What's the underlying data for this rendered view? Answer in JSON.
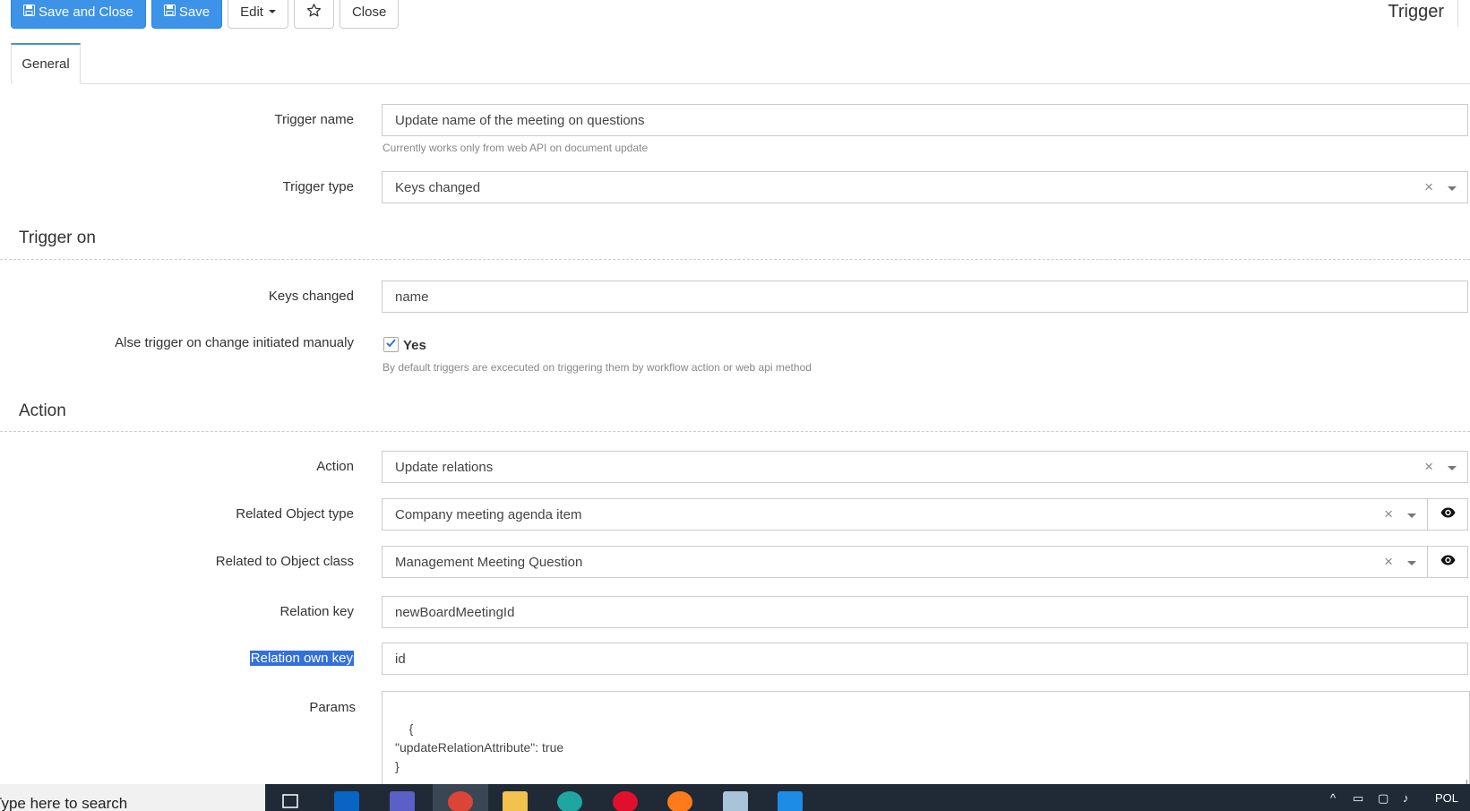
{
  "toolbar": {
    "save_and_close": "Save and Close",
    "save": "Save",
    "edit": "Edit",
    "close": "Close"
  },
  "page_heading": "Trigger",
  "tabs": [
    {
      "label": "General",
      "active": true
    }
  ],
  "form": {
    "trigger_name": {
      "label": "Trigger name",
      "value": "Update name of the meeting on questions",
      "help": "Currently works only from web API on document update"
    },
    "trigger_type": {
      "label": "Trigger type",
      "value": "Keys changed"
    },
    "section_trigger_on": "Trigger on",
    "keys_changed": {
      "label": "Keys changed",
      "value": "name"
    },
    "also_trigger": {
      "label": "Alse trigger on change initiated manualy",
      "checked": true,
      "checkbox_label": "Yes",
      "help": "By default triggers are excecuted on triggering them by workflow action or web api method"
    },
    "section_action": "Action",
    "action": {
      "label": "Action",
      "value": "Update relations"
    },
    "related_object_type": {
      "label": "Related Object type",
      "value": "Company meeting agenda item"
    },
    "related_object_class": {
      "label": "Related to Object class",
      "value": "Management Meeting Question"
    },
    "relation_key": {
      "label": "Relation key",
      "value": "newBoardMeetingId"
    },
    "relation_own_key": {
      "label": "Relation own key",
      "value": "id"
    },
    "params": {
      "label": "Params",
      "value": "{\n\"updateRelationAttribute\": true\n}"
    }
  },
  "taskbar": {
    "search_placeholder": "Type here to search",
    "language": "POL"
  },
  "colors": {
    "primary": "#3d93e8",
    "tab_accent": "#4a90d9",
    "selection": "#3370d8",
    "taskbar": "#1f2a36"
  }
}
